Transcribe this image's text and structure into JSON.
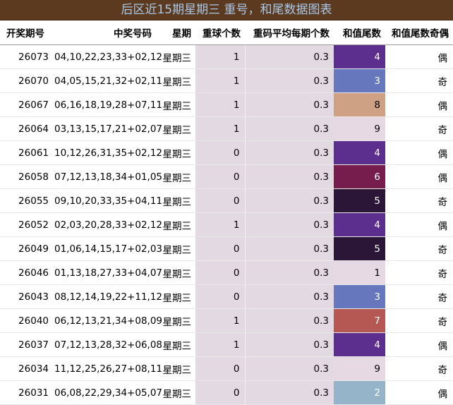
{
  "title": "后区近15期星期三  重号，和尾数据图表",
  "columns": {
    "issue": "开奖期号",
    "numbers": "中奖号码",
    "weekday": "星期",
    "repeat_count": "重球个数",
    "repeat_avg": "重码平均每期个数",
    "sum_tail": "和值尾数",
    "sum_tail_parity": "和值尾数奇偶"
  },
  "tail_colors": {
    "1": "#e6d9e4",
    "2": "#95b3c9",
    "3": "#6677bd",
    "4": "#5c2f8e",
    "5": "#2c1638",
    "6": "#761d4e",
    "7": "#b55753",
    "8": "#cfa184",
    "9": "#e6d9e4"
  },
  "tail_text_colors": {
    "1": "#000000",
    "2": "#ffffff",
    "3": "#ffffff",
    "4": "#ffffff",
    "5": "#ffffff",
    "6": "#ffffff",
    "7": "#ffffff",
    "8": "#000000",
    "9": "#000000"
  },
  "rows": [
    {
      "issue": "26073",
      "numbers": "04,10,22,23,33+02,12",
      "weekday": "星期三",
      "repeat": "1",
      "avg": "0.3",
      "tail": "4",
      "parity": "偶"
    },
    {
      "issue": "26070",
      "numbers": "04,05,15,21,32+02,11",
      "weekday": "星期三",
      "repeat": "1",
      "avg": "0.3",
      "tail": "3",
      "parity": "奇"
    },
    {
      "issue": "26067",
      "numbers": "06,16,18,19,28+07,11",
      "weekday": "星期三",
      "repeat": "1",
      "avg": "0.3",
      "tail": "8",
      "parity": "偶"
    },
    {
      "issue": "26064",
      "numbers": "03,13,15,17,21+02,07",
      "weekday": "星期三",
      "repeat": "1",
      "avg": "0.3",
      "tail": "9",
      "parity": "奇"
    },
    {
      "issue": "26061",
      "numbers": "10,12,26,31,35+02,12",
      "weekday": "星期三",
      "repeat": "0",
      "avg": "0.3",
      "tail": "4",
      "parity": "偶"
    },
    {
      "issue": "26058",
      "numbers": "07,12,13,18,34+01,05",
      "weekday": "星期三",
      "repeat": "0",
      "avg": "0.3",
      "tail": "6",
      "parity": "偶"
    },
    {
      "issue": "26055",
      "numbers": "09,10,20,33,35+04,11",
      "weekday": "星期三",
      "repeat": "0",
      "avg": "0.3",
      "tail": "5",
      "parity": "奇"
    },
    {
      "issue": "26052",
      "numbers": "02,03,20,28,33+02,12",
      "weekday": "星期三",
      "repeat": "1",
      "avg": "0.3",
      "tail": "4",
      "parity": "偶"
    },
    {
      "issue": "26049",
      "numbers": "01,06,14,15,17+02,03",
      "weekday": "星期三",
      "repeat": "0",
      "avg": "0.3",
      "tail": "5",
      "parity": "奇"
    },
    {
      "issue": "26046",
      "numbers": "01,13,18,27,33+04,07",
      "weekday": "星期三",
      "repeat": "0",
      "avg": "0.3",
      "tail": "1",
      "parity": "奇"
    },
    {
      "issue": "26043",
      "numbers": "08,12,14,19,22+11,12",
      "weekday": "星期三",
      "repeat": "0",
      "avg": "0.3",
      "tail": "3",
      "parity": "奇"
    },
    {
      "issue": "26040",
      "numbers": "06,12,13,21,34+08,09",
      "weekday": "星期三",
      "repeat": "1",
      "avg": "0.3",
      "tail": "7",
      "parity": "奇"
    },
    {
      "issue": "26037",
      "numbers": "07,12,13,28,32+06,08",
      "weekday": "星期三",
      "repeat": "1",
      "avg": "0.3",
      "tail": "4",
      "parity": "偶"
    },
    {
      "issue": "26034",
      "numbers": "11,12,25,26,27+08,11",
      "weekday": "星期三",
      "repeat": "0",
      "avg": "0.3",
      "tail": "9",
      "parity": "奇"
    },
    {
      "issue": "26031",
      "numbers": "06,08,22,29,34+05,07",
      "weekday": "星期三",
      "repeat": "0",
      "avg": "0.3",
      "tail": "2",
      "parity": "偶"
    }
  ]
}
